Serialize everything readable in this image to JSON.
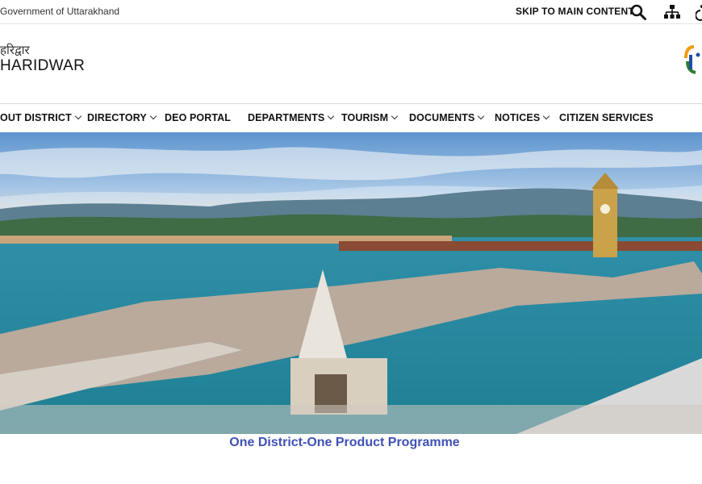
{
  "topbar": {
    "gov_label": "Government of Uttarakhand",
    "skip_label": "SKIP TO MAIN CONTENT",
    "icons": [
      "search-icon",
      "sitemap-icon",
      "accessibility-icon"
    ]
  },
  "header": {
    "title_hindi": "हरिद्वार",
    "title": "HARIDWAR",
    "logo": "digital-india-logo"
  },
  "nav": {
    "items": [
      {
        "label": "OUT DISTRICT",
        "dropdown": true
      },
      {
        "label": "DIRECTORY",
        "dropdown": true
      },
      {
        "label": "DEO PORTAL",
        "dropdown": false
      },
      {
        "label": "DEPARTMENTS",
        "dropdown": true
      },
      {
        "label": "TOURISM",
        "dropdown": true
      },
      {
        "label": "DOCUMENTS",
        "dropdown": true
      },
      {
        "label": "NOTICES",
        "dropdown": true
      },
      {
        "label": "CITIZEN SERVICES",
        "dropdown": false
      }
    ]
  },
  "banner": {
    "image": "har-ki-pauri-ghat-panorama"
  },
  "odop": {
    "title": "One District-One Product Programme"
  },
  "colors": {
    "link_blue": "#3f51b5",
    "text": "#111111"
  }
}
